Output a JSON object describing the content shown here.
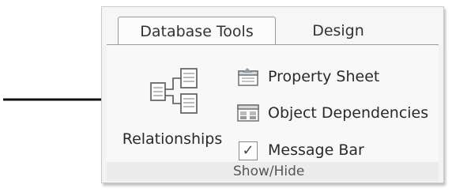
{
  "ribbon": {
    "tabs": [
      {
        "label": "Database Tools",
        "active": true
      },
      {
        "label": "Design",
        "active": false
      }
    ],
    "group": {
      "label": "Show/Hide",
      "large_button": {
        "label": "Relationships",
        "icon": "relationships-icon"
      },
      "commands": [
        {
          "label": "Property Sheet",
          "icon": "property-sheet-icon"
        },
        {
          "label": "Object Dependencies",
          "icon": "object-dependencies-icon"
        },
        {
          "label": "Message Bar",
          "icon": "checkbox",
          "checked": true,
          "check_glyph": "✓"
        }
      ]
    }
  },
  "annotation": {
    "type": "pointer-arrow",
    "target": "Relationships"
  },
  "colors": {
    "ribbon_bg": "#f3f3f3",
    "border": "#9a9a9a",
    "text": "#2a2a2a"
  }
}
